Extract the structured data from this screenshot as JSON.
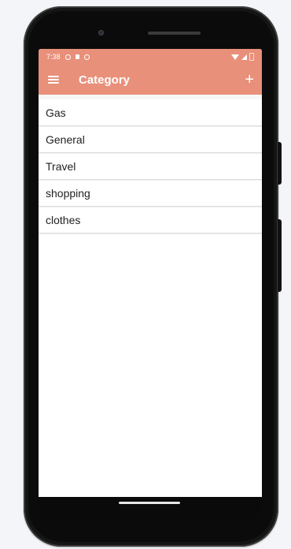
{
  "status_bar": {
    "time": "7:38",
    "icons_left": [
      "shield-icon",
      "sd-card-icon",
      "record-icon"
    ],
    "icons_right": [
      "wifi-icon",
      "signal-icon",
      "battery-icon"
    ]
  },
  "app_bar": {
    "title": "Category",
    "menu_icon": "hamburger-menu-icon",
    "add_label": "+",
    "color": "#e8907a"
  },
  "categories": [
    {
      "label": "Gas"
    },
    {
      "label": "General"
    },
    {
      "label": "Travel"
    },
    {
      "label": "shopping"
    },
    {
      "label": "clothes"
    }
  ]
}
